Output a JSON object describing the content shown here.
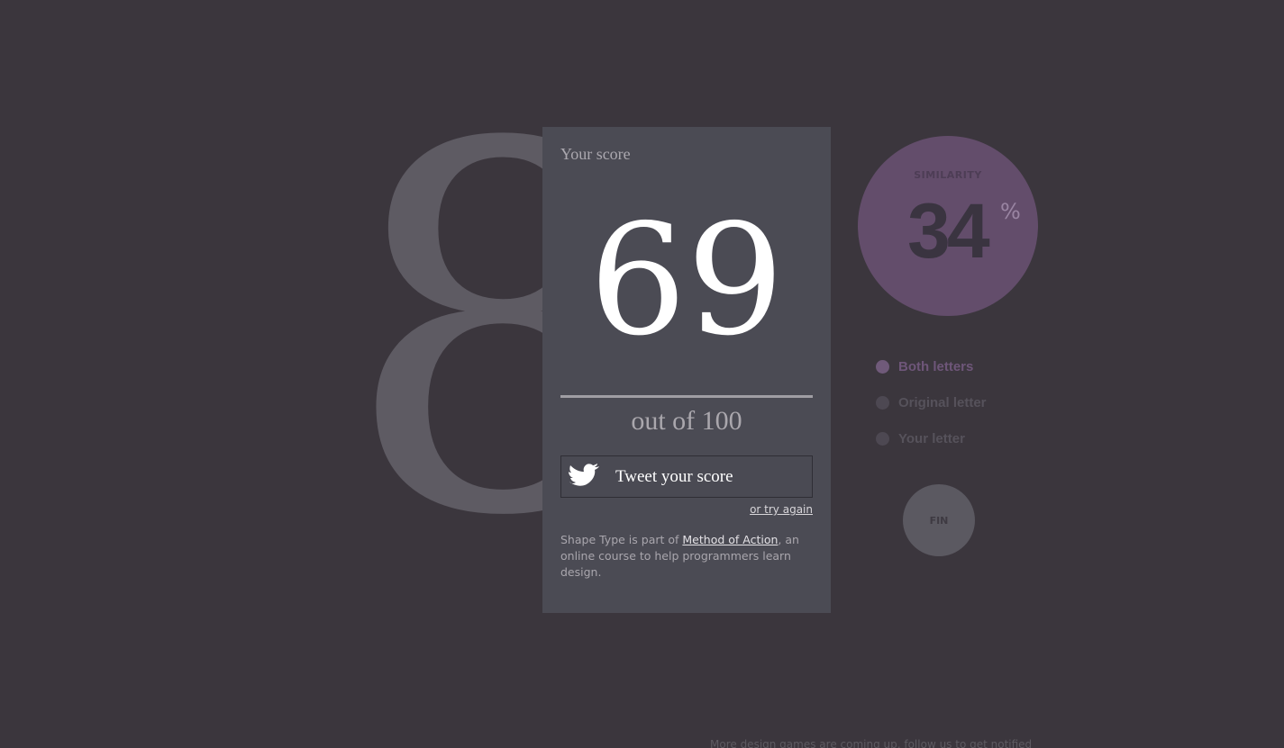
{
  "glyph": {
    "character": "8"
  },
  "score": {
    "heading": "Your score",
    "value": "69",
    "out_of": "out of 100",
    "tweet_label": "Tweet your score",
    "tweet_icon": "twitter-bird-icon",
    "retry_label": "or try again"
  },
  "about": {
    "text_before": "Shape Type is part of ",
    "link_label": "Method of Action",
    "text_after": ", an online course to help programmers learn design."
  },
  "similarity": {
    "label": "SIMILARITY",
    "value": "34",
    "unit": "%"
  },
  "legend": {
    "items": [
      {
        "label": "Both letters",
        "active": true
      },
      {
        "label": "Original letter",
        "active": false
      },
      {
        "label": "Your letter",
        "active": false
      }
    ]
  },
  "fin_label": "FIN",
  "footer_note": "More design games are coming up, follow us to get notified",
  "colors": {
    "background": "#3b363d",
    "panel": "#4b4b54",
    "accent": "#634d6b"
  }
}
